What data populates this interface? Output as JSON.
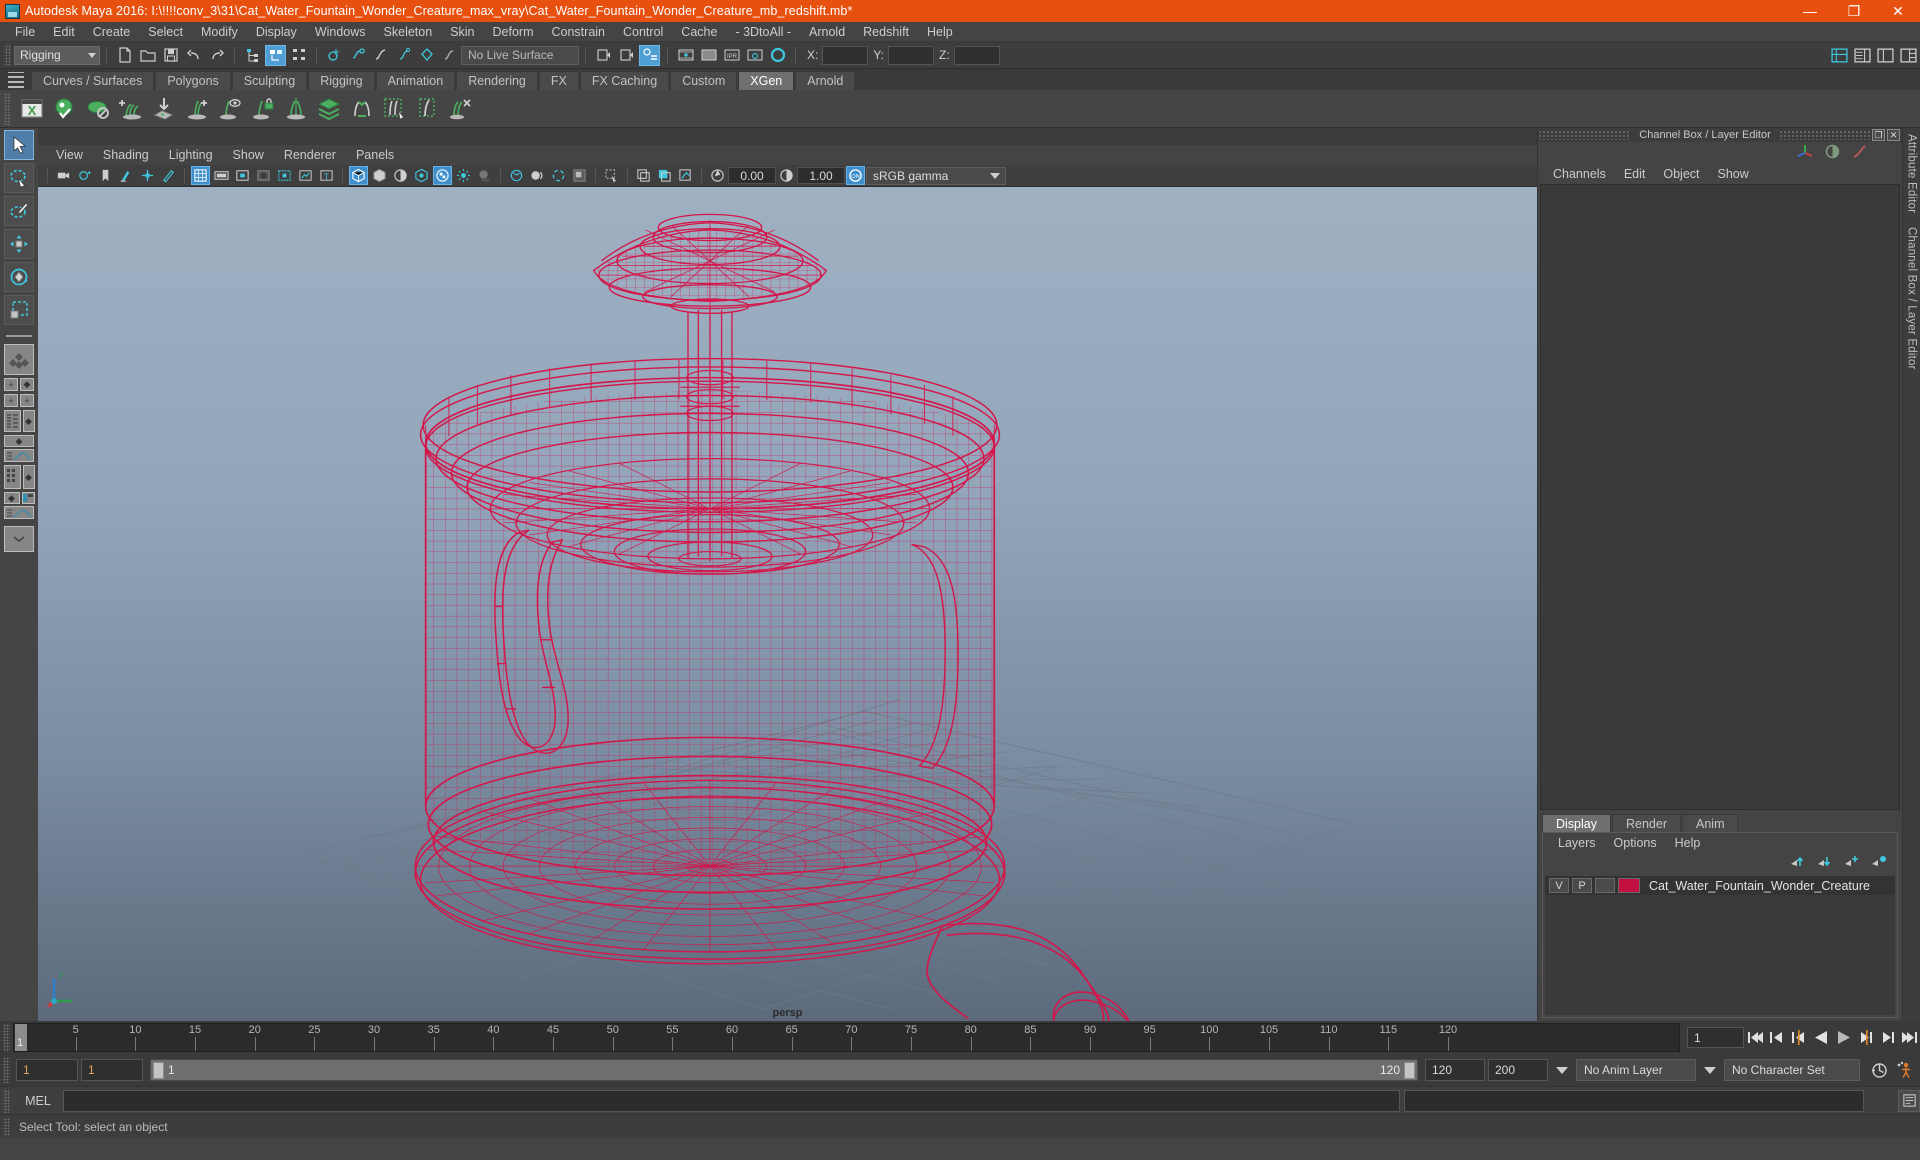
{
  "window": {
    "title": "Autodesk Maya 2016: I:\\!!!!conv_3\\31\\Cat_Water_Fountain_Wonder_Creature_max_vray\\Cat_Water_Fountain_Wonder_Creature_mb_redshift.mb*",
    "minimize": "—",
    "maximize": "❐",
    "close": "✕",
    "titlebar_color": "#e8500f"
  },
  "menubar": {
    "items": [
      "File",
      "Edit",
      "Create",
      "Select",
      "Modify",
      "Display",
      "Windows",
      "Skeleton",
      "Skin",
      "Deform",
      "Constrain",
      "Control",
      "Cache",
      "- 3DtoAll -",
      "Arnold",
      "Redshift",
      "Help"
    ]
  },
  "statusline": {
    "menu_set": "Rigging",
    "live_surface": "No Live Surface",
    "axis_x_label": "X:",
    "axis_y_label": "Y:",
    "axis_z_label": "Z:",
    "axis_x_value": "",
    "axis_y_value": "",
    "axis_z_value": ""
  },
  "shelf": {
    "tabs": [
      "Curves / Surfaces",
      "Polygons",
      "Sculpting",
      "Rigging",
      "Animation",
      "Rendering",
      "FX",
      "FX Caching",
      "Custom",
      "XGen",
      "Arnold"
    ],
    "active_tab": "XGen",
    "icons": [
      "xgen-editor-icon",
      "xgen-preview-icon",
      "xgen-disable-preview-icon",
      "add-grooming-description-icon",
      "import-collection-icon",
      "add-guide-icon",
      "guide-visibility-icon",
      "lock-guide-icon",
      "mirror-guide-icon",
      "layers-icon",
      "groom-flow-icon",
      "select-guides-region-icon",
      "clear-region-icon",
      "delete-guide-icon"
    ]
  },
  "toolbox": {
    "items": [
      "select-tool",
      "lasso-select-tool",
      "paint-select-tool",
      "move-tool",
      "rotate-tool",
      "scale-tool",
      "last-tool",
      "layout-single",
      "layout-quad",
      "layout-outliner-persp",
      "layout-persp-graph",
      "layout-hypershade-persp",
      "layout-persp-graph2",
      "layout-menu"
    ],
    "selected": "select-tool"
  },
  "viewport": {
    "panel_menus": [
      "View",
      "Shading",
      "Lighting",
      "Show",
      "Renderer",
      "Panels"
    ],
    "exposure_value": "0.00",
    "gamma_value": "1.00",
    "color_transform": "sRGB gamma",
    "camera_label": "persp",
    "axis_x": "x",
    "axis_y": "y",
    "wireframe_color": "#d4164a",
    "background_top": "#9fb0c2",
    "background_bottom": "#5d6b7d"
  },
  "channelbox": {
    "panel_title": "Channel Box / Layer Editor",
    "menus": [
      "Channels",
      "Edit",
      "Object",
      "Show"
    ],
    "restore_glyph": "❐",
    "close_glyph": "✕"
  },
  "layer_editor": {
    "tabs": [
      "Display",
      "Render",
      "Anim"
    ],
    "active_tab": "Display",
    "menus": [
      "Layers",
      "Options",
      "Help"
    ],
    "layers": [
      {
        "visibility": "V",
        "playback": "P",
        "shading": "",
        "color": "#c21040",
        "name": "Cat_Water_Fountain_Wonder_Creature"
      }
    ]
  },
  "side_tabs": [
    "Attribute Editor",
    "Channel Box / Layer Editor"
  ],
  "timeslider": {
    "ticks": [
      5,
      10,
      15,
      20,
      25,
      30,
      35,
      40,
      45,
      50,
      55,
      60,
      65,
      70,
      75,
      80,
      85,
      90,
      95,
      100,
      105,
      110,
      115,
      120
    ],
    "current_frame": "1",
    "current_frame_field": "1",
    "range_start": 1,
    "range_end": 120,
    "playback_buttons": [
      "go-to-start",
      "step-back-key",
      "step-back-frame",
      "play-backwards",
      "play-forwards",
      "step-forward-frame",
      "step-forward-key",
      "go-to-end"
    ]
  },
  "rangeslider": {
    "anim_start": "1",
    "anim_end": "1",
    "range_bar_start": "1",
    "range_bar_end": "120",
    "playback_end": "120",
    "anim_end_total": "200",
    "anim_layer": "No Anim Layer",
    "character_set": "No Character Set"
  },
  "commandline": {
    "language": "MEL",
    "input_value": "",
    "output_value": ""
  },
  "helpline": {
    "text": "Select Tool: select an object"
  }
}
